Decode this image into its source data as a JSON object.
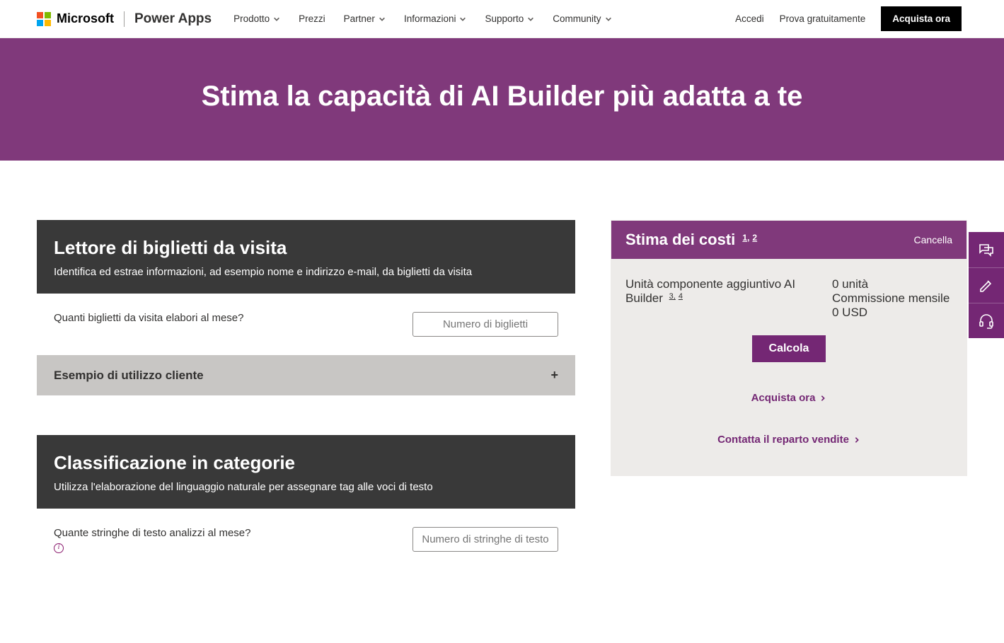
{
  "nav": {
    "microsoft": "Microsoft",
    "brand": "Power Apps",
    "items": [
      "Prodotto",
      "Prezzi",
      "Partner",
      "Informazioni",
      "Supporto",
      "Community"
    ],
    "items_caret": [
      true,
      false,
      true,
      true,
      true,
      true
    ],
    "signin": "Accedi",
    "try": "Prova gratuitamente",
    "buy": "Acquista ora"
  },
  "hero": {
    "title": "Stima la capacità di AI Builder più adatta a te"
  },
  "cards": [
    {
      "title": "Lettore di biglietti da visita",
      "desc": "Identifica ed estrae informazioni, ad esempio nome e indirizzo e-mail, da biglietti da visita",
      "question": "Quanti biglietti da visita elabori al mese?",
      "placeholder": "Numero di biglietti",
      "has_info": false,
      "accordion_label": "Esempio di utilizzo cliente"
    },
    {
      "title": "Classificazione in categorie",
      "desc": "Utilizza l'elaborazione del linguaggio naturale per assegnare tag alle voci di testo",
      "question": "Quante stringhe di testo analizzi al mese? ",
      "placeholder": "Numero di stringhe di testo",
      "has_info": true,
      "accordion_label": ""
    }
  ],
  "cost": {
    "title": "Stima dei costi",
    "sup1": "1,",
    "sup2": "2",
    "clear": "Cancella",
    "unit_label": "Unità componente aggiuntivo AI Builder",
    "unit_sup1": "3,",
    "unit_sup2": "4",
    "units_value": "0 unità",
    "fee_label": "Commissione mensile 0 USD",
    "calc": "Calcola",
    "buy_now": "Acquista ora",
    "contact": "Contatta il reparto vendite"
  },
  "rail": {
    "items": [
      "chat-icon",
      "pencil-icon",
      "headset-icon"
    ]
  }
}
